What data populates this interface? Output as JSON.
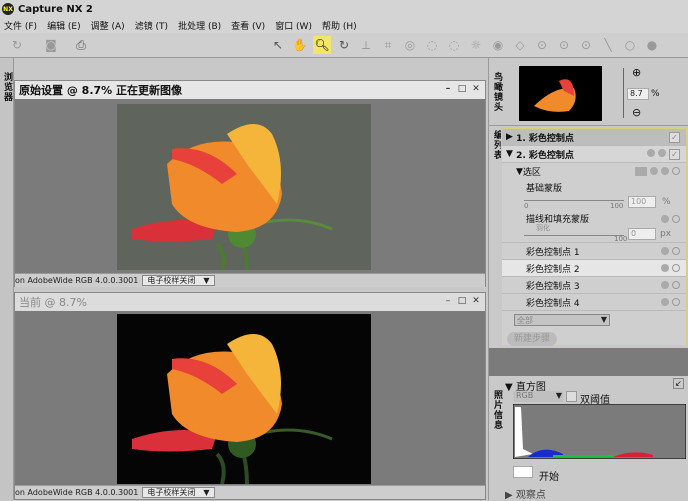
{
  "app": {
    "title": "Capture NX 2",
    "logo": "NX"
  },
  "menu": [
    "文件 (F)",
    "编辑 (E)",
    "调整 (A)",
    "滤镜 (T)",
    "批处理 (B)",
    "查看 (V)",
    "窗口 (W)",
    "帮助 (H)"
  ],
  "toolbar": {
    "left_icons": [
      "rotate-icon",
      "camera-icon",
      "print-icon"
    ],
    "tools": [
      "arrow-icon",
      "hand-icon",
      "zoom-icon",
      "rotate-icon",
      "straighten-icon",
      "crop-icon",
      "red-eye-icon",
      "lasso-icon",
      "lasso-icon",
      "brightness-icon",
      "eye-icon",
      "tag-icon",
      "control-point-icon",
      "control-point-icon",
      "control-point-icon",
      "line-icon",
      "circle-icon",
      "fill-icon"
    ],
    "active": "zoom-icon",
    "accent": "#f2e66a"
  },
  "left_strip": {
    "label": "浏览器"
  },
  "windows": [
    {
      "title": "原始设置 @ 8.7% 正在更新图像",
      "status": "on AdobeWide RGB 4.0.0.3001",
      "proof": "电子校样关闭",
      "background": "grey"
    },
    {
      "title": "当前 @ 8.7%",
      "status": "on AdobeWide RGB 4.0.0.3001",
      "proof": "电子校样关闭",
      "background": "black"
    }
  ],
  "birdseye": {
    "label": "鸟瞰镜头",
    "zoom": "8.7",
    "unit": "%"
  },
  "edit_list": {
    "label": "编列表",
    "steps": [
      {
        "label": "1. 彩色控制点",
        "expanded": false,
        "checked": true
      },
      {
        "label": "2. 彩色控制点",
        "expanded": true,
        "checked": true
      }
    ],
    "selection": "选区",
    "base_mask": {
      "label": "基础蒙版",
      "min": "0",
      "max": "100",
      "value": "100",
      "unit": "%"
    },
    "paint_mask": {
      "label": "描线和填充蒙版",
      "feather_label": "羽化",
      "max": "100",
      "value": "0",
      "unit": "px"
    },
    "points": [
      "彩色控制点 1",
      "彩色控制点 2",
      "彩色控制点 3",
      "彩色控制点 4"
    ],
    "filter": "全部",
    "new_step": "新建步骤"
  },
  "photo_info": {
    "label": "照片信息",
    "histogram": "直方图",
    "channel": "RGB",
    "dual": "双阈值",
    "start": "开始",
    "watch": "观察点"
  }
}
